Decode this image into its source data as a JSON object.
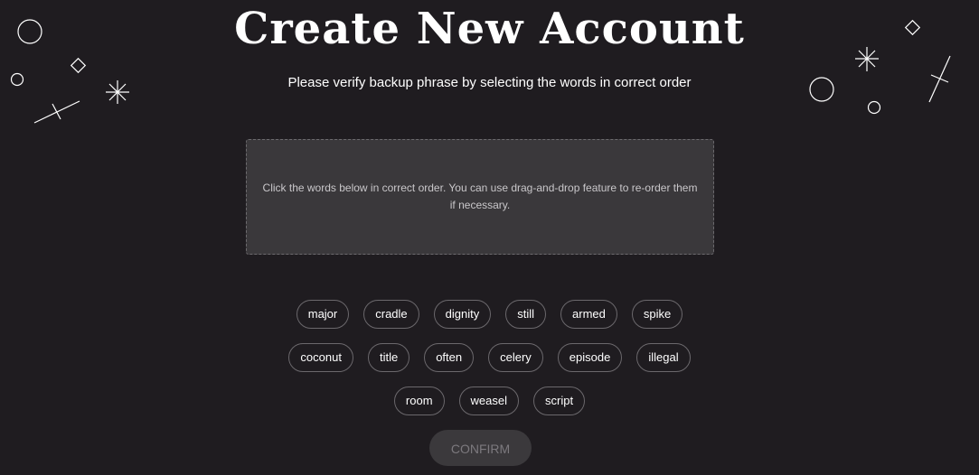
{
  "header": {
    "title": "Create New Account",
    "subtitle": "Please verify backup phrase by selecting the words in correct order"
  },
  "dropzone": {
    "instruction": "Click the words below in correct order. You can use drag-and-drop feature to re-order them if necessary."
  },
  "words": {
    "row1": [
      "major",
      "cradle",
      "dignity",
      "still",
      "armed",
      "spike"
    ],
    "row2": [
      "coconut",
      "title",
      "often",
      "celery",
      "episode",
      "illegal"
    ],
    "row3": [
      "room",
      "weasel",
      "script"
    ]
  },
  "confirm_button": {
    "label": "CONFIRM",
    "disabled": true
  },
  "colors": {
    "background": "#1f1c20",
    "dropzone_fill": "#3a383b",
    "chip_border": "#6b686c",
    "confirm_disabled_bg": "#3b393c",
    "confirm_disabled_text": "#7c797e"
  },
  "decorations": [
    "circle-icon",
    "diamond-icon",
    "sparkle-icon",
    "line-icon"
  ]
}
